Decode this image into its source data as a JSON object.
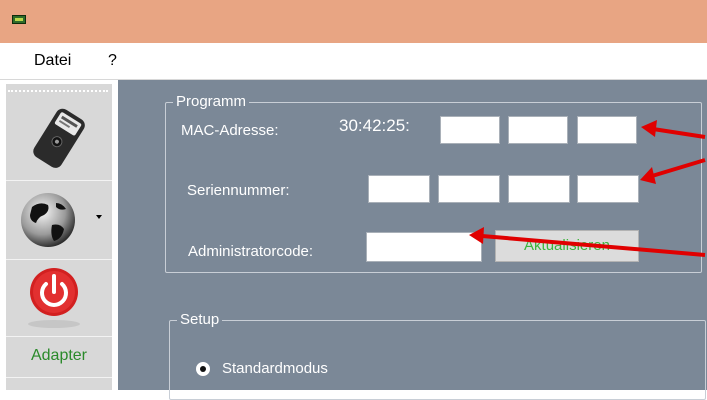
{
  "menu": {
    "items": [
      "Datei",
      "?"
    ]
  },
  "toolbar": {
    "buttons": [
      {
        "name": "remote-key-button",
        "icon": "key-fob-icon"
      },
      {
        "name": "globe-dropdown-button",
        "icon": "globe-icon"
      },
      {
        "name": "power-button",
        "icon": "power-icon"
      }
    ],
    "adapter_label": "Adapter"
  },
  "programm": {
    "title": "Programm",
    "mac_label": "MAC-Adresse:",
    "mac_prefix": "30:42:25:",
    "serial_label": "Seriennummer:",
    "admin_label": "Administratorcode:",
    "update_button": "Aktualisieren"
  },
  "setup": {
    "title": "Setup",
    "mode_option": "Standardmodus"
  },
  "colors": {
    "titlebar": "#e8a583",
    "panel": "#7b8897",
    "accent_green": "#3cb43c",
    "annotation_arrow": "#e00000"
  }
}
